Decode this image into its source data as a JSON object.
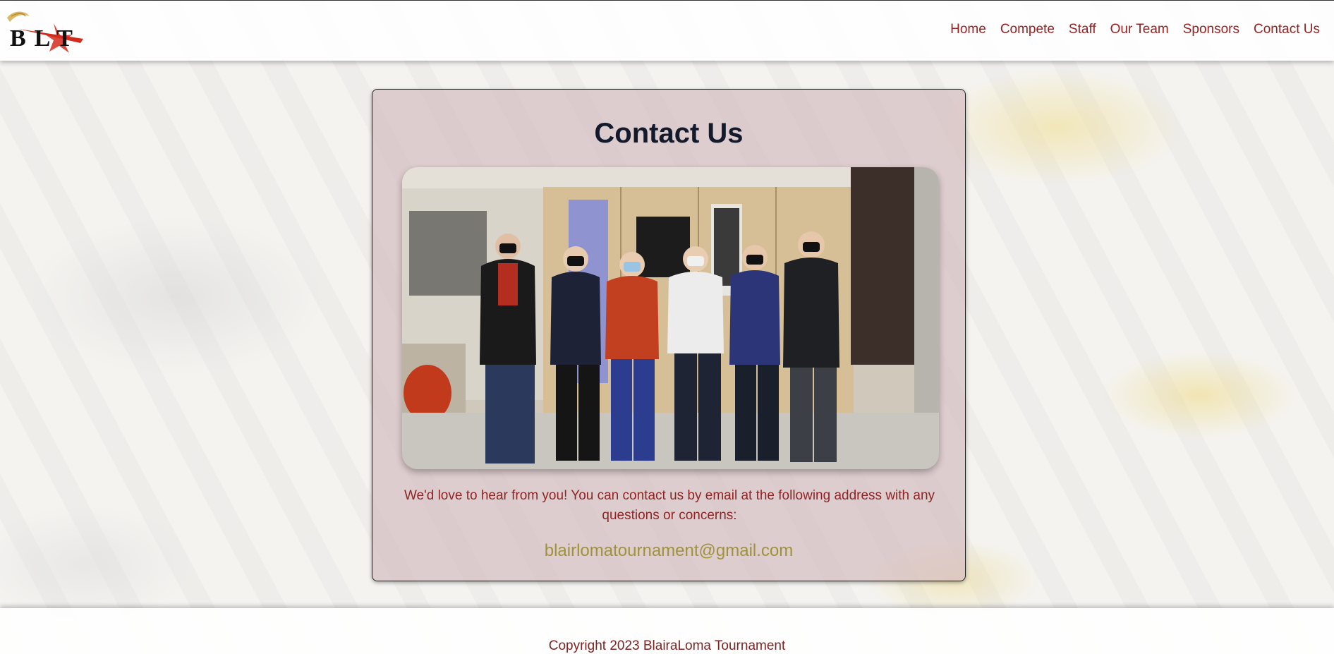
{
  "header": {
    "logo": {
      "text": "BLT",
      "icon": "blt-star-logo"
    },
    "nav": [
      {
        "label": "Home"
      },
      {
        "label": "Compete"
      },
      {
        "label": "Staff"
      },
      {
        "label": "Our Team"
      },
      {
        "label": "Sponsors"
      },
      {
        "label": "Contact Us"
      }
    ]
  },
  "main": {
    "title": "Contact Us",
    "photo": {
      "icon": "team-group-photo"
    },
    "description": "We'd love to hear from you! You can contact us by email at the following address with any questions or concerns:",
    "email": "blairlomatournament@gmail.com"
  },
  "footer": {
    "copyright": "Copyright 2023 BlairaLoma Tournament"
  },
  "colors": {
    "nav_text": "#9a2121",
    "title": "#131a2c",
    "body_text": "#8e2424",
    "email": "#a0923a",
    "card_bg": "#d6bec0"
  }
}
